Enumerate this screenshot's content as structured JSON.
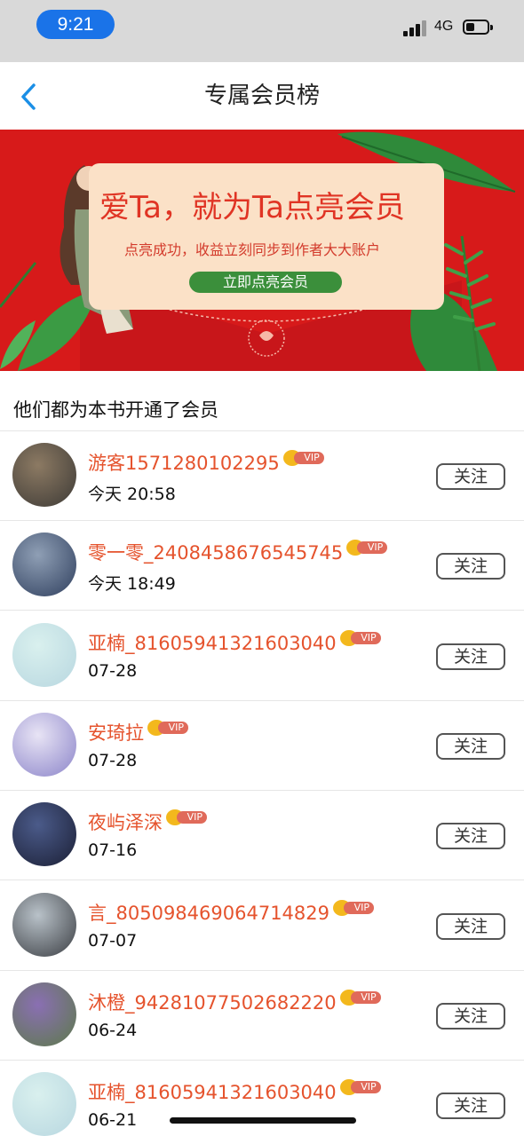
{
  "status": {
    "time": "9:21",
    "network": "4G"
  },
  "header": {
    "title": "专属会员榜"
  },
  "banner": {
    "headline": "爱Ta，就为Ta点亮会员",
    "subtitle": "点亮成功，收益立刻同步到作者大大账户",
    "cta": "立即点亮会员"
  },
  "section": {
    "heading": "他们都为本书开通了会员"
  },
  "vip_label": "VIP",
  "follow_label": "关注",
  "members": [
    {
      "name": "游客1571280102295",
      "time": "今天 20:58",
      "avatar": "avatar-child",
      "colors": [
        "#8c7a63",
        "#3d3a36"
      ]
    },
    {
      "name": "零一零_2408458676545745",
      "time": "今天 18:49",
      "avatar": "avatar-cat",
      "colors": [
        "#8f9fb5",
        "#2f3f5e"
      ]
    },
    {
      "name": "亚楠_81605941321603040",
      "time": "07-28",
      "avatar": "avatar-illustration",
      "colors": [
        "#d9f0ee",
        "#b8d7e0"
      ]
    },
    {
      "name": "安琦拉",
      "time": "07-28",
      "avatar": "avatar-anime-girl",
      "colors": [
        "#e8e4f5",
        "#8b84c9"
      ]
    },
    {
      "name": "夜屿泽深",
      "time": "07-16",
      "avatar": "avatar-anime-boy",
      "colors": [
        "#4b5b8a",
        "#1b1f35"
      ]
    },
    {
      "name": "言_805098469064714829",
      "time": "07-07",
      "avatar": "avatar-person-photo",
      "colors": [
        "#b9c2c9",
        "#3a3d42"
      ]
    },
    {
      "name": "沐橙_94281077502682220",
      "time": "06-24",
      "avatar": "avatar-lavender-field",
      "colors": [
        "#8a6fb3",
        "#5d7a4a"
      ]
    },
    {
      "name": "亚楠_81605941321603040",
      "time": "06-21",
      "avatar": "avatar-illustration",
      "colors": [
        "#d9f0ee",
        "#b8d7e0"
      ]
    }
  ]
}
